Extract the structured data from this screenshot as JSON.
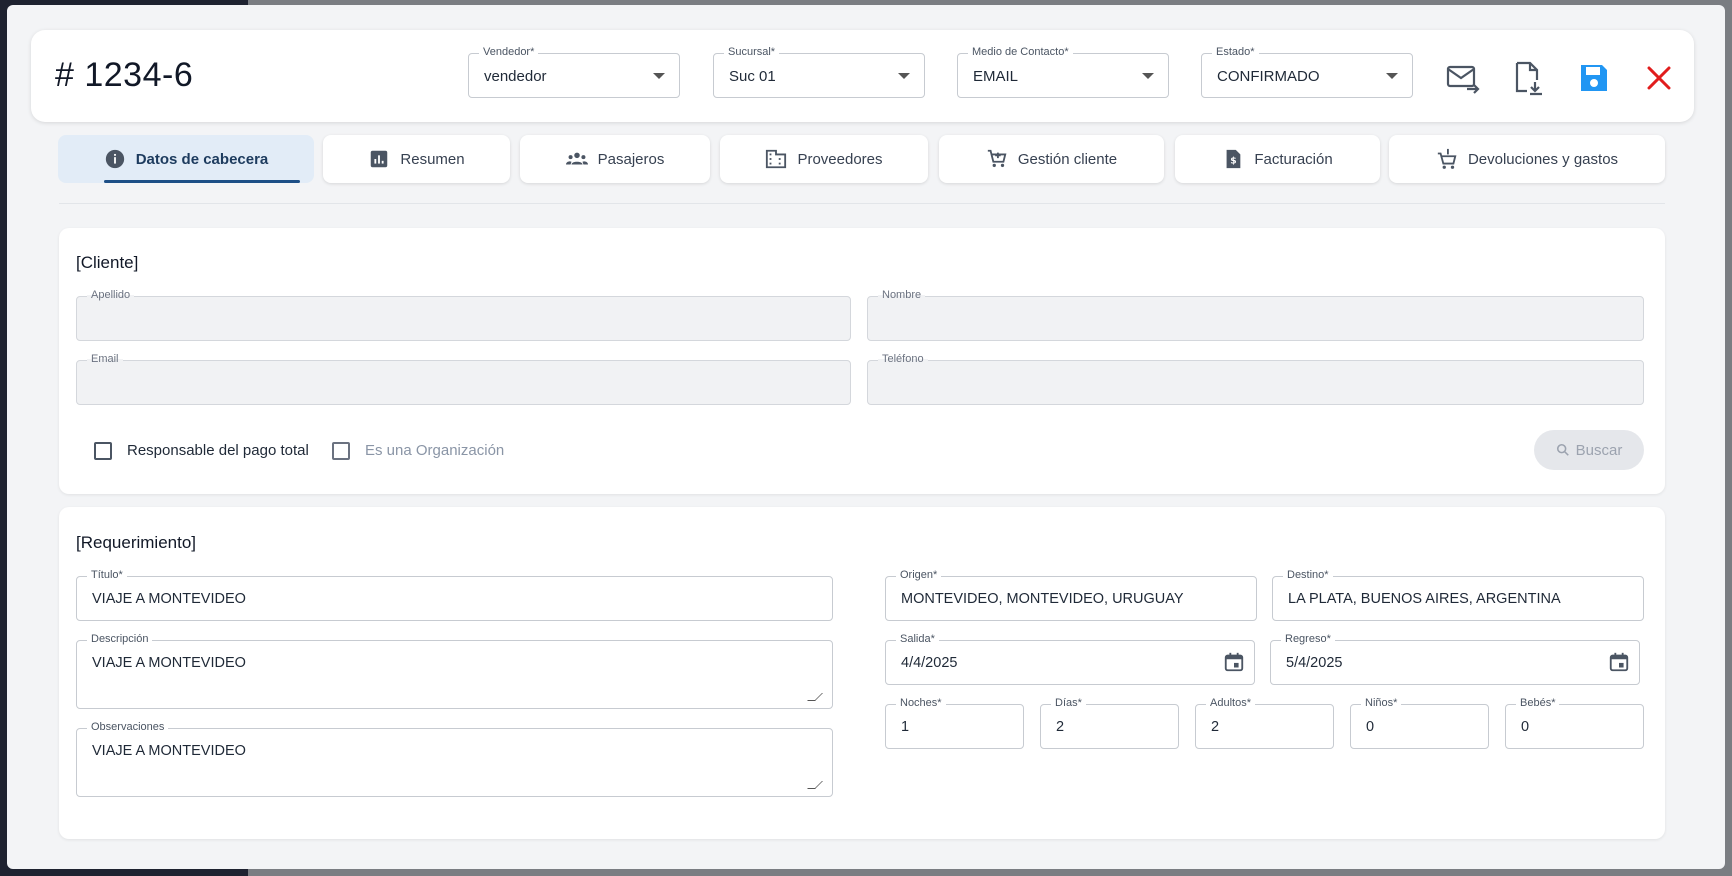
{
  "header": {
    "doc_number": "# 1234-6",
    "selects": {
      "vendedor": {
        "label": "Vendedor*",
        "value": "vendedor"
      },
      "sucursal": {
        "label": "Sucursal*",
        "value": "Suc 01"
      },
      "medio": {
        "label": "Medio de Contacto*",
        "value": "EMAIL"
      },
      "estado": {
        "label": "Estado*",
        "value": "CONFIRMADO"
      }
    },
    "icons": [
      "send-email-icon",
      "download-document-icon",
      "save-icon",
      "close-icon"
    ]
  },
  "tabs": [
    {
      "label": "Datos de cabecera",
      "icon": "info-icon",
      "active": true
    },
    {
      "label": "Resumen",
      "icon": "chart-icon"
    },
    {
      "label": "Pasajeros",
      "icon": "people-icon"
    },
    {
      "label": "Proveedores",
      "icon": "building-icon"
    },
    {
      "label": "Gestión cliente",
      "icon": "cart-icon"
    },
    {
      "label": "Facturación",
      "icon": "invoice-icon"
    },
    {
      "label": "Devoluciones y gastos",
      "icon": "cart-return-icon"
    }
  ],
  "cliente": {
    "title": "[Cliente]",
    "apellido": {
      "label": "Apellido",
      "value": ""
    },
    "nombre": {
      "label": "Nombre",
      "value": ""
    },
    "email": {
      "label": "Email",
      "value": ""
    },
    "telefono": {
      "label": "Teléfono",
      "value": ""
    },
    "responsable_label": "Responsable del pago total",
    "organizacion_label": "Es una Organización",
    "buscar_label": "Buscar"
  },
  "requerimiento": {
    "title": "[Requerimiento]",
    "titulo": {
      "label": "Título*",
      "value": "VIAJE A MONTEVIDEO"
    },
    "descripcion": {
      "label": "Descripción",
      "value": "VIAJE A MONTEVIDEO"
    },
    "observaciones": {
      "label": "Observaciones",
      "value": "VIAJE A MONTEVIDEO"
    },
    "origen": {
      "label": "Origen*",
      "value": "MONTEVIDEO, MONTEVIDEO, URUGUAY"
    },
    "destino": {
      "label": "Destino*",
      "value": "LA PLATA, BUENOS AIRES, ARGENTINA"
    },
    "salida": {
      "label": "Salida*",
      "value": "4/4/2025"
    },
    "regreso": {
      "label": "Regreso*",
      "value": "5/4/2025"
    },
    "noches": {
      "label": "Noches*",
      "value": "1"
    },
    "dias": {
      "label": "Días*",
      "value": "2"
    },
    "adultos": {
      "label": "Adultos*",
      "value": "2"
    },
    "ninos": {
      "label": "Niños*",
      "value": "0"
    },
    "bebes": {
      "label": "Bebés*",
      "value": "0"
    }
  },
  "colors": {
    "accent": "#1d4f86",
    "save": "#2196f3",
    "close": "#e11d1d"
  }
}
